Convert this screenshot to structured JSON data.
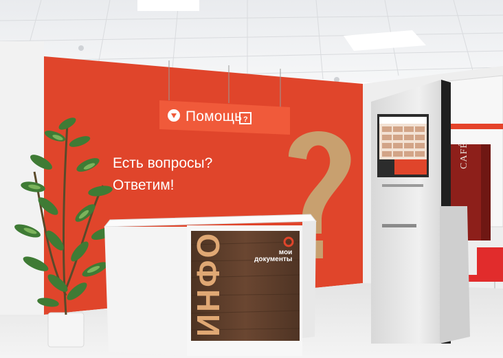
{
  "sign": {
    "text": "Помощь"
  },
  "wall": {
    "line1": "Есть вопросы?",
    "line2": "Ответим!"
  },
  "counter": {
    "vertical_text": "ИНФО",
    "logo_line1": "мои",
    "logo_line2": "документы"
  },
  "cafe": {
    "text": "CAFÉ"
  },
  "colors": {
    "wall_red": "#e0452b",
    "sign_orange": "#f05a3a",
    "wood": "#5a3b28",
    "question_mark": "#c8a06f"
  }
}
